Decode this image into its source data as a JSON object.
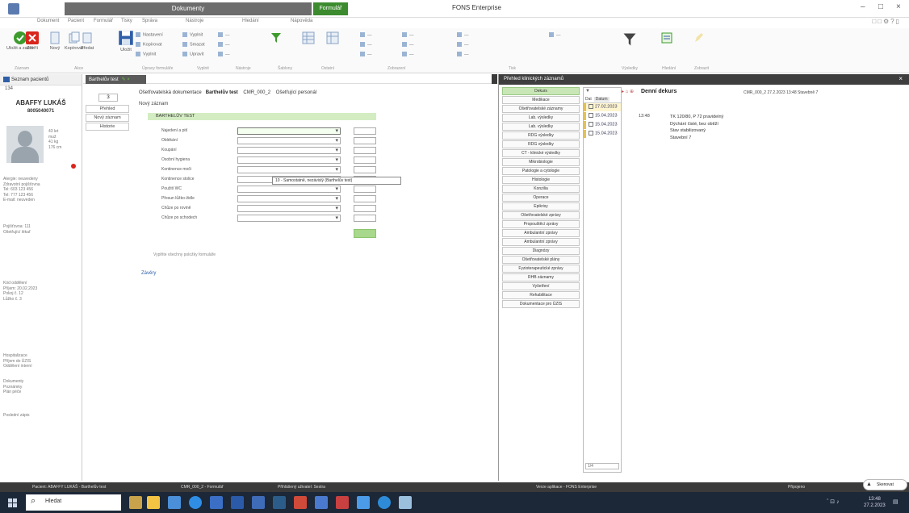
{
  "titlebar": {
    "context_tab": "Dokumenty",
    "context_tab2": "Formulář",
    "app_title": "FONS Enterprise",
    "controls": [
      "–",
      "□",
      "×"
    ]
  },
  "ribbon_tabs": [
    "Dokument",
    "Pacient",
    "Formulář",
    "Tisky",
    "Správa",
    "Nástroje",
    "Hledání",
    "Nápověda"
  ],
  "ribbon": {
    "big_buttons": [
      "Uložit a zavřít",
      "Zavřít",
      "Nový",
      "Kopírovat",
      "Předat",
      "Uložit"
    ],
    "small_items_a": [
      "Nastavení",
      "Kopírovat",
      "Vyplnit"
    ],
    "small_items_b": [
      "Vyplnit",
      "Smazat",
      "Upravit"
    ],
    "groups": [
      "Záznam",
      "Akce",
      "Úpravy formuláře",
      "Vyplnit",
      "Nástroje",
      "Šablony",
      "Ostatní",
      "Zobrazení",
      "Tisk",
      "Výsledky",
      "Hledání",
      "Zobrazit"
    ]
  },
  "patient": {
    "header": "Seznam pacientů",
    "row2": "134",
    "name": "ABAFFY LUKÁŠ",
    "id": "8005040071",
    "info_lines": [
      "43 let",
      "muž",
      "41 kg",
      "176 cm"
    ],
    "lines_a": [
      "Alergie: neuvedeny",
      "Zdravotní pojišťovna",
      "Tel: 603 123 456",
      "Tel: 777 123 456",
      "E-mail: neuveden"
    ],
    "lines_b": [
      "Pojišťovna: 111",
      "Ošetřující lékař"
    ],
    "lines_c": [
      "Kód oddělení",
      "Příjem: 20.02.2023",
      "Pokoj č. 12",
      "Lůžko č. 3"
    ],
    "lines_d": [
      "Hospitalizace",
      "Příjem do ÚZIS",
      "Oddělení interní"
    ],
    "lines_e": [
      "Dokumenty",
      "Poznámky",
      "Plán péče"
    ],
    "lines_f": [
      "Poslední zápis"
    ]
  },
  "doc": {
    "tab_label": "Barthelův test",
    "sidebtn_top": "3",
    "side_buttons": [
      "Přehled",
      "Nový záznam",
      "Historie"
    ],
    "form_title": "Ošetřovatelská dokumentace",
    "form_name": "Barthelův test",
    "form_code": "CMR_000_2",
    "form_author": "Ošetřující personál",
    "section1": "Nový záznam",
    "test_bar": "BARTHELŮV TEST",
    "rows": [
      "Najedení a pití",
      "Oblékání",
      "Koupání",
      "Osobní hygiena",
      "Kontinence moči",
      "Kontinence stolice",
      "Použití WC",
      "Přesun lůžko-židle",
      "Chůze po rovině",
      "Chůze po schodech"
    ],
    "tooltip": "10 - Samostatně, nezávislý (Barthelův test)",
    "footnote": "Vyplňte všechny položky formuláře",
    "zavery": "Závěry"
  },
  "rpanel": {
    "title": "Přehled klinických záznamů",
    "categories": [
      "Dekurs",
      "Medikace",
      "Ošetřovatelské záznamy",
      "Lab. výsledky",
      "Lab. výsledky",
      "RDG výsledky",
      "RDG výsledky",
      "CT - klinické výsledky",
      "Mikrobiologie",
      "Patologie a cytologie",
      "Histologie",
      "Konzilia",
      "Operace",
      "Epikrisy",
      "Ošetřovatelské zprávy",
      "Propouštěcí zprávy",
      "Ambulantní zprávy",
      "Ambulantní zprávy",
      "Diagnózy",
      "Ošetřovatelské plány",
      "Fyzioterapeutické zprávy",
      "RHB záznamy",
      "Vyšetření",
      "Rehabilitace",
      "Dokumentace pro ÚZIS"
    ],
    "list_top": "▼",
    "list_header": [
      "Dat",
      "Datum"
    ],
    "list_rows": [
      "27.02.2023",
      "15.04.2023",
      "15.04.2023",
      "15.04.2023"
    ],
    "list_scroll": "1/4",
    "detail_title": "Denní dekurs",
    "detail_meta": "CMR_000_2   27.2.2023 13:48   Stavebně 7",
    "detail_time": "13:48",
    "detail_lines": [
      "TK 120/80, P 72 pravidelný",
      "Dýchání čisté, bez obtíží",
      "Stav stabilizovaný",
      "Stavební 7"
    ]
  },
  "statusbar": {
    "left": "Pacient: ABAFFY LUKÁŠ - Barthelův test",
    "mid1": "CMR_000_2 - Formulář",
    "mid2": "Přihlášený uživatel: Sestra",
    "mid3": "Verze aplikace - FONS Enterprise",
    "right": "Připojeno",
    "scan": "Skenovat"
  },
  "taskbar": {
    "search": "Hledat",
    "clock_time": "13:48",
    "clock_date": "27.2.2023"
  }
}
